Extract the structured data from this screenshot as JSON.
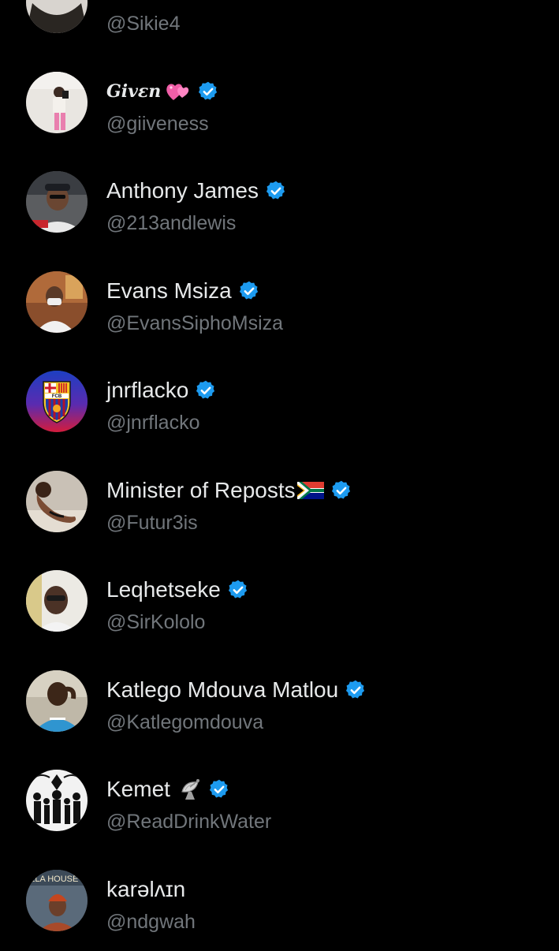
{
  "theme": {
    "background": "#000000",
    "name_color": "#e7e9ea",
    "handle_color": "#71767b",
    "verified_color": "#1d9bf0"
  },
  "users": [
    {
      "display_name": "",
      "handle": "@Sikie4",
      "verified": false,
      "avatar": "partial-avatar"
    },
    {
      "display_name": "Givεn",
      "emoji": "heart-icon",
      "handle": "@giiveness",
      "verified": true,
      "avatar": "photo-woman-mirror-selfie"
    },
    {
      "display_name": "Anthony James",
      "handle": "@213andlewis",
      "verified": true,
      "avatar": "photo-man-in-car-cap"
    },
    {
      "display_name": "Evans Msiza",
      "handle": "@EvansSiphoMsiza",
      "verified": true,
      "avatar": "photo-man-with-mask"
    },
    {
      "display_name": "jnrflacko",
      "handle": "@jnrflacko",
      "verified": true,
      "avatar": "fcb-crest-logo"
    },
    {
      "display_name": "Minister of Reposts",
      "emoji": "south-africa-flag-icon",
      "handle": "@Futur3is",
      "verified": true,
      "avatar": "photo-woman-posing"
    },
    {
      "display_name": "Leqhetseke",
      "handle": "@SirKololo",
      "verified": true,
      "avatar": "photo-man-selfie-glasses"
    },
    {
      "display_name": "Katlego Mdouva Matlou",
      "handle": "@Katlegomdouva",
      "verified": true,
      "avatar": "photo-man-blue-shirt"
    },
    {
      "display_name": "Kemet",
      "emoji": "satellite-dish-icon",
      "handle": "@ReadDrinkWater",
      "verified": true,
      "avatar": "illustration-silhouettes"
    },
    {
      "display_name": "karəlʌɪn",
      "handle": "@ndgwah",
      "verified": false,
      "avatar": "photo-woman-house-sign"
    }
  ],
  "avatar_texts": {
    "fcb": "FCB",
    "house_sign": "ELA HOUSE"
  }
}
